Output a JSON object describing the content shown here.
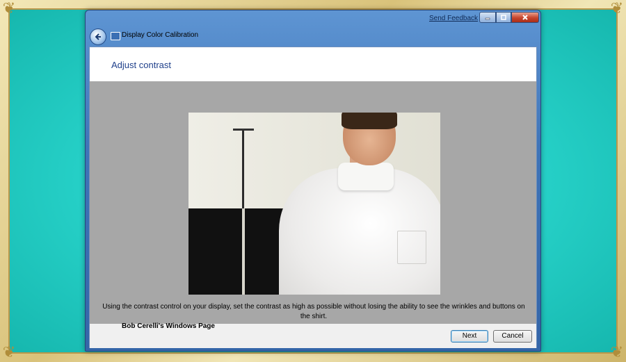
{
  "window": {
    "title": "Display Color Calibration",
    "send_feedback": "Send Feedback"
  },
  "page": {
    "heading": "Adjust contrast",
    "instruction": "Using the contrast control on your display, set the contrast as high as possible without losing the ability to see the wrinkles and buttons on the shirt.",
    "watermark": "Bob Cerelli's Windows Page"
  },
  "buttons": {
    "next": "Next",
    "cancel": "Cancel"
  },
  "icons": {
    "back": "back-arrow-icon",
    "app": "display-calibration-icon",
    "minimize": "minimize-icon",
    "maximize": "maximize-icon",
    "close": "close-icon"
  },
  "colors": {
    "titlebar": "#3f74b8",
    "heading": "#1e3f8a",
    "content_bg": "#a7a7a7",
    "frame_bg": "#25cfc6",
    "close_button": "#c7442c"
  }
}
